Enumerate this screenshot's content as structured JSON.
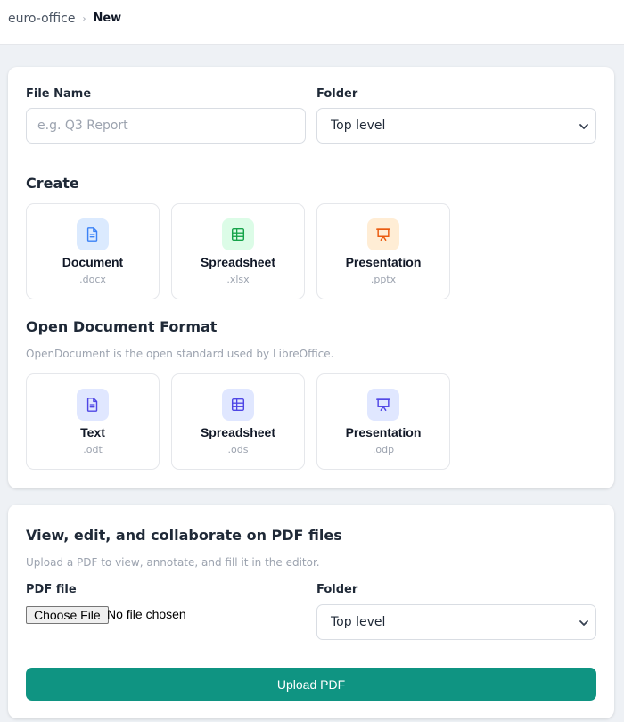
{
  "breadcrumb": {
    "root": "euro-office",
    "separator": "›",
    "current": "New"
  },
  "form": {
    "file_name_label": "File Name",
    "file_name_placeholder": "e.g. Q3 Report",
    "file_name_value": "",
    "folder_label": "Folder",
    "folder_value": "Top level"
  },
  "create": {
    "title": "Create",
    "tiles": [
      {
        "name": "Document",
        "ext": ".docx",
        "icon": "document-icon",
        "color": "#3b82f6",
        "bg": "#dbeafe"
      },
      {
        "name": "Spreadsheet",
        "ext": ".xlsx",
        "icon": "spreadsheet-icon",
        "color": "#16a34a",
        "bg": "#dcfce7"
      },
      {
        "name": "Presentation",
        "ext": ".pptx",
        "icon": "presentation-icon",
        "color": "#ea580c",
        "bg": "#ffedd5"
      }
    ]
  },
  "odf": {
    "title": "Open Document Format",
    "subtitle": "OpenDocument is the open standard used by LibreOffice.",
    "tiles": [
      {
        "name": "Text",
        "ext": ".odt",
        "icon": "document-icon",
        "color": "#4f46e5",
        "bg": "#e0e7ff"
      },
      {
        "name": "Spreadsheet",
        "ext": ".ods",
        "icon": "spreadsheet-icon",
        "color": "#4f46e5",
        "bg": "#e0e7ff"
      },
      {
        "name": "Presentation",
        "ext": ".odp",
        "icon": "presentation-icon",
        "color": "#4f46e5",
        "bg": "#e0e7ff"
      }
    ]
  },
  "pdf": {
    "title": "View, edit, and collaborate on PDF files",
    "subtitle": "Upload a PDF to view, annotate, and fill it in the editor.",
    "file_label": "PDF file",
    "choose_file_label": "Choose File",
    "no_file_text": "No file chosen",
    "folder_label": "Folder",
    "folder_value": "Top level",
    "upload_label": "Upload PDF"
  },
  "colors": {
    "accent": "#0f9482",
    "background": "#eef1f5"
  }
}
